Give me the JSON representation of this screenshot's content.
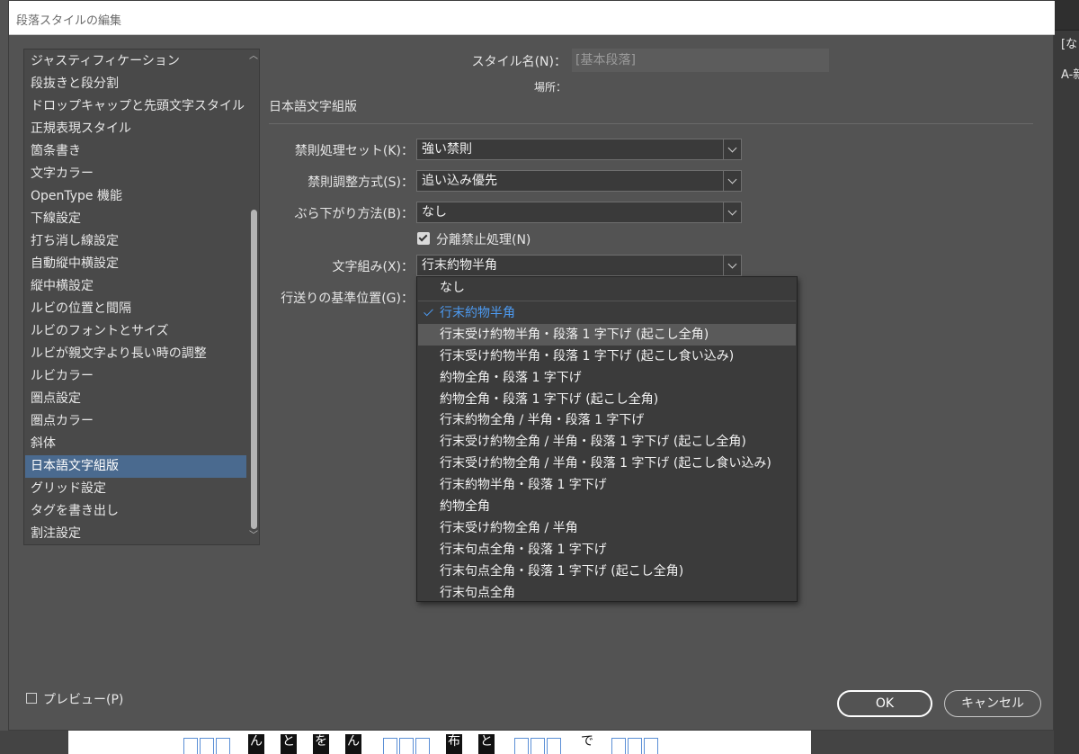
{
  "dialog": {
    "title": "段落スタイルの編集"
  },
  "background": {
    "right_text_1": "[な",
    "right_text_2": "A-新",
    "canvas_chars": [
      "ん",
      "と",
      "を",
      "ん",
      "布",
      "と",
      "で"
    ]
  },
  "sidebar": {
    "items": [
      "ジャスティフィケーション",
      "段抜きと段分割",
      "ドロップキャップと先頭文字スタイル",
      "正規表現スタイル",
      "箇条書き",
      "文字カラー",
      "OpenType 機能",
      "下線設定",
      "打ち消し線設定",
      "自動縦中横設定",
      "縦中横設定",
      "ルビの位置と間隔",
      "ルビのフォントとサイズ",
      "ルビが親文字より長い時の調整",
      "ルビカラー",
      "圏点設定",
      "圏点カラー",
      "斜体",
      "日本語文字組版",
      "グリッド設定",
      "タグを書き出し",
      "割注設定"
    ],
    "selected_index": 18
  },
  "header": {
    "style_name_label": "スタイル名(N)：",
    "style_name_value": "[基本段落]",
    "location_label": "場所：",
    "section_title": "日本語文字組版"
  },
  "fields": {
    "kinsoku_set_label": "禁則処理セット(K)：",
    "kinsoku_set_value": "強い禁則",
    "kinsoku_adjust_label": "禁則調整方式(S)：",
    "kinsoku_adjust_value": "追い込み優先",
    "hanging_label": "ぶら下がり方法(B)：",
    "hanging_value": "なし",
    "no_break_label": "分離禁止処理(N)",
    "no_break_checked": true,
    "mojikumi_label": "文字組み(X)：",
    "mojikumi_value": "行末約物半角",
    "leading_base_label": "行送りの基準位置(G)："
  },
  "dropdown": {
    "items": [
      "なし",
      "行末約物半角",
      "行末受け約物半角・段落 1 字下げ (起こし全角)",
      "行末受け約物半角・段落 1 字下げ (起こし食い込み)",
      "約物全角・段落 1 字下げ",
      "約物全角・段落 1 字下げ (起こし全角)",
      "行末約物全角 / 半角・段落 1 字下げ",
      "行末受け約物全角 / 半角・段落 1 字下げ (起こし全角)",
      "行末受け約物全角 / 半角・段落 1 字下げ (起こし食い込み)",
      "行末約物半角・段落 1 字下げ",
      "約物全角",
      "行末受け約物全角 / 半角",
      "行末句点全角・段落 1 字下げ",
      "行末句点全角・段落 1 字下げ (起こし全角)",
      "行末句点全角"
    ],
    "checked_index": 1,
    "hover_index": 2
  },
  "footer": {
    "preview_label": "プレビュー(P)",
    "ok_label": "OK",
    "cancel_label": "キャンセル"
  },
  "colors": {
    "selection": "#4a6a8f",
    "check_accent": "#4d9bf2",
    "dialog_bg": "#535353"
  }
}
